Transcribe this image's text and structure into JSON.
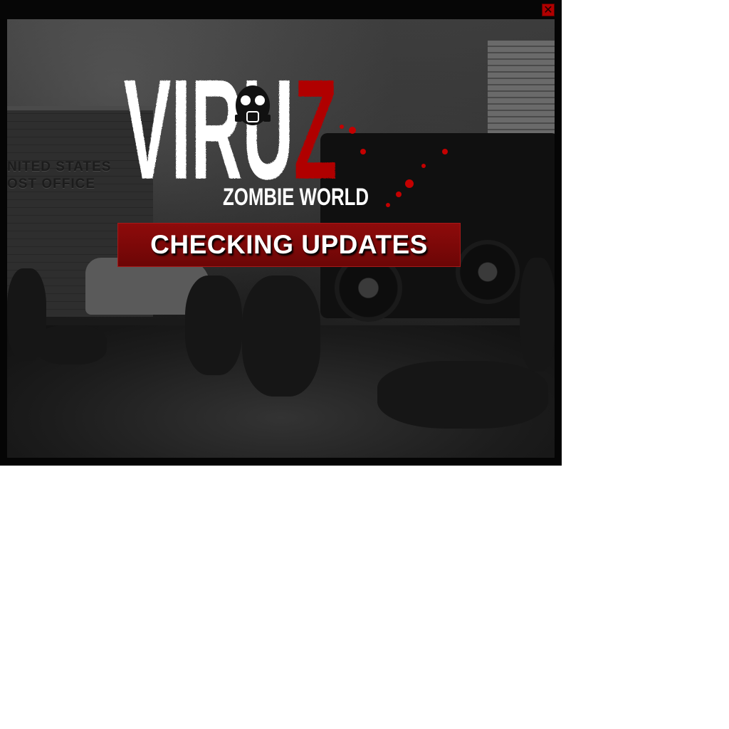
{
  "window": {
    "close_label": "✕"
  },
  "logo": {
    "title": "VIRUZ",
    "subtitle": "ZOMBIE WORLD",
    "icon": "gas-mask-icon"
  },
  "background": {
    "sign_line1": "NITED STATES",
    "sign_line2": "OST OFFICE"
  },
  "status": {
    "text": "CHECKING UPDATES"
  },
  "colors": {
    "accent": "#b00000",
    "banner": "#7a0808",
    "text": "#ffffff"
  }
}
